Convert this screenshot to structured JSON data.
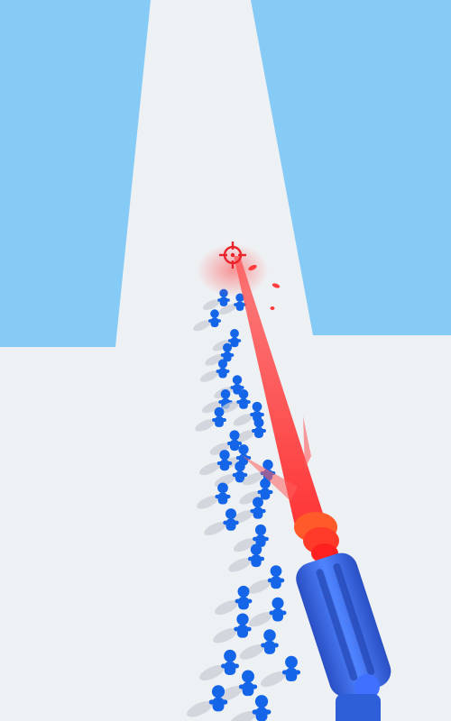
{
  "scene": {
    "colors": {
      "sky": "#86caf6",
      "track": "#eef1f4",
      "laser": "#ff3b3b",
      "crowd": "#1565e8",
      "shadow": "#c9ced6",
      "reticle": "#e8242a",
      "gun_body": "#2f5fd8",
      "gun_ring": "#ff5a2a"
    },
    "icons": {
      "reticle": "crosshair-icon"
    }
  }
}
